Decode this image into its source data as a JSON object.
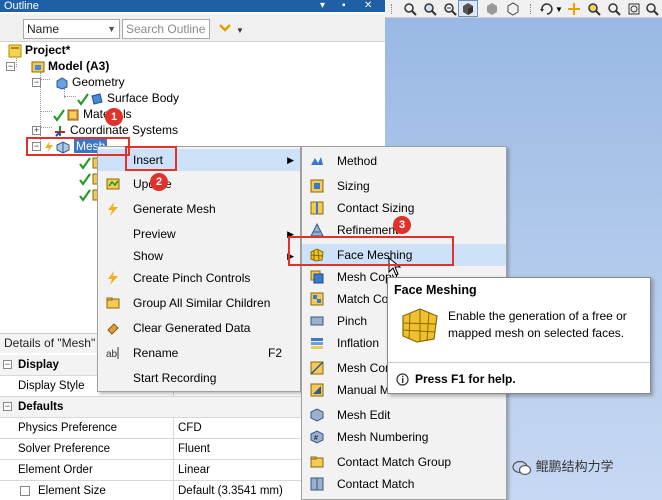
{
  "outline": {
    "title": "Outline",
    "title_buttons": [
      "▾",
      "▪",
      "✕"
    ],
    "name_filter": "Name",
    "search_placeholder": "Search Outline"
  },
  "tree": {
    "project": "Project*",
    "model": "Model (A3)",
    "geometry": "Geometry",
    "surface_body": "Surface Body",
    "materials": "Materials",
    "coordinate_systems": "Coordinate Systems",
    "mesh": "Mesh"
  },
  "context_menu": {
    "items": [
      {
        "label": "Insert",
        "icon": "none",
        "submenu": true
      },
      {
        "label": "Update",
        "icon": "update-icon"
      },
      {
        "label": "Generate Mesh",
        "icon": "lightning-icon"
      },
      {
        "label": "Preview",
        "icon": "none",
        "submenu": true
      },
      {
        "label": "Show",
        "icon": "none",
        "submenu": true
      },
      {
        "label": "Create Pinch Controls",
        "icon": "lightning-icon"
      },
      {
        "label": "Group All Similar Children",
        "icon": "folder-icon"
      },
      {
        "label": "Clear Generated Data",
        "icon": "eraser-icon"
      },
      {
        "label": "Rename",
        "icon": "rename-icon",
        "shortcut": "F2"
      },
      {
        "label": "Start Recording",
        "icon": "none"
      }
    ]
  },
  "insert_menu": {
    "items": [
      {
        "label": "Method",
        "icon": "method-icon"
      },
      {
        "label": "Sizing",
        "icon": "sizing-icon"
      },
      {
        "label": "Contact Sizing",
        "icon": "contact-sizing-icon"
      },
      {
        "label": "Refinement",
        "icon": "refinement-icon"
      },
      {
        "label": "Face Meshing",
        "icon": "face-meshing-icon"
      },
      {
        "label": "Mesh Copy",
        "icon": "mesh-copy-icon"
      },
      {
        "label": "Match Control",
        "icon": "match-control-icon"
      },
      {
        "label": "Pinch",
        "icon": "pinch-icon"
      },
      {
        "label": "Inflation",
        "icon": "inflation-icon"
      },
      {
        "label": "Mesh Connection",
        "icon": "mesh-connection-icon"
      },
      {
        "label": "Manual Mesh Connection",
        "icon": "manual-mesh-connection-icon"
      },
      {
        "label": "Mesh Edit",
        "icon": "mesh-edit-icon"
      },
      {
        "label": "Mesh Numbering",
        "icon": "mesh-numbering-icon"
      },
      {
        "label": "Contact Match Group",
        "icon": "contact-match-group-icon"
      },
      {
        "label": "Contact Match",
        "icon": "contact-match-icon"
      }
    ]
  },
  "tooltip": {
    "title": "Face Meshing",
    "description": "Enable the generation of a free or mapped mesh on selected faces.",
    "help": "Press F1 for help."
  },
  "details": {
    "header": "Details of \"Mesh\"",
    "sections": {
      "display": "Display",
      "defaults": "Defaults"
    },
    "rows": [
      {
        "key": "Display Style",
        "value": ""
      },
      {
        "key": "Physics Preference",
        "value": "CFD"
      },
      {
        "key": "Solver Preference",
        "value": "Fluent"
      },
      {
        "key": "Element Order",
        "value": "Linear"
      },
      {
        "key": "Element Size",
        "value": "Default (3.3541 mm)"
      }
    ]
  },
  "annotations": {
    "badges": [
      "1",
      "2",
      "3"
    ],
    "color": "#e0312b"
  },
  "watermark": "鲲鹏结构力学",
  "colors": {
    "selection": "#3a78c9",
    "highlight": "#cde2f8",
    "title_bar": "#1f5fa6"
  }
}
